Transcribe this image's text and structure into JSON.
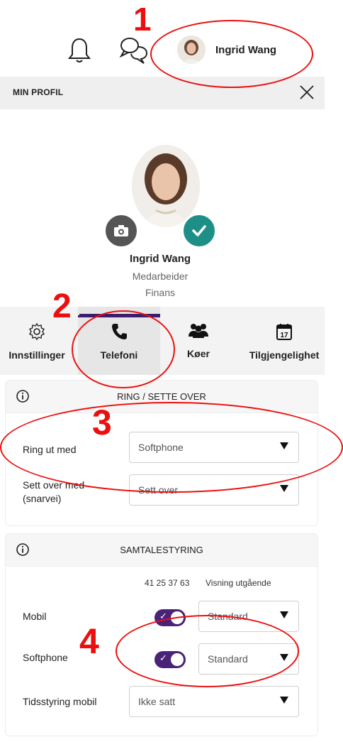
{
  "topbar": {
    "user_name": "Ingrid Wang",
    "icons": [
      "bell-icon",
      "chat-icon"
    ]
  },
  "profile_panel": {
    "title": "MIN PROFIL",
    "name": "Ingrid Wang",
    "role": "Medarbeider",
    "department": "Finans",
    "badges": [
      "camera-icon",
      "check-icon"
    ]
  },
  "tabs": [
    {
      "label": "Innstillinger",
      "icon": "gear-icon"
    },
    {
      "label": "Telefoni",
      "icon": "phone-icon",
      "selected": true
    },
    {
      "label": "Køer",
      "icon": "people-icon"
    },
    {
      "label": "Tilgjengelighet",
      "icon": "calendar-icon",
      "day": "17"
    }
  ],
  "ring_section": {
    "title": "RING / SETTE OVER",
    "rows": [
      {
        "label": "Ring ut med",
        "value": "Softphone"
      },
      {
        "label": "Sett over med (snarvei)",
        "value": "Sett over"
      }
    ]
  },
  "samtale_section": {
    "title": "SAMTALESTYRING",
    "col_number": "41 25 37 63",
    "col_display": "Visning utgående",
    "rows": [
      {
        "label": "Mobil",
        "toggle": true,
        "value": "Standard"
      },
      {
        "label": "Softphone",
        "toggle": true,
        "value": "Standard"
      },
      {
        "label": "Tidsstyring mobil",
        "value": "Ikke satt"
      }
    ]
  },
  "annotations": [
    "1",
    "2",
    "3",
    "4"
  ],
  "colors": {
    "annotation": "#ec0f0f",
    "toggle_on": "#4a2277",
    "status_check": "#1e8f86",
    "tab_indicator": "#3b1d6e"
  }
}
